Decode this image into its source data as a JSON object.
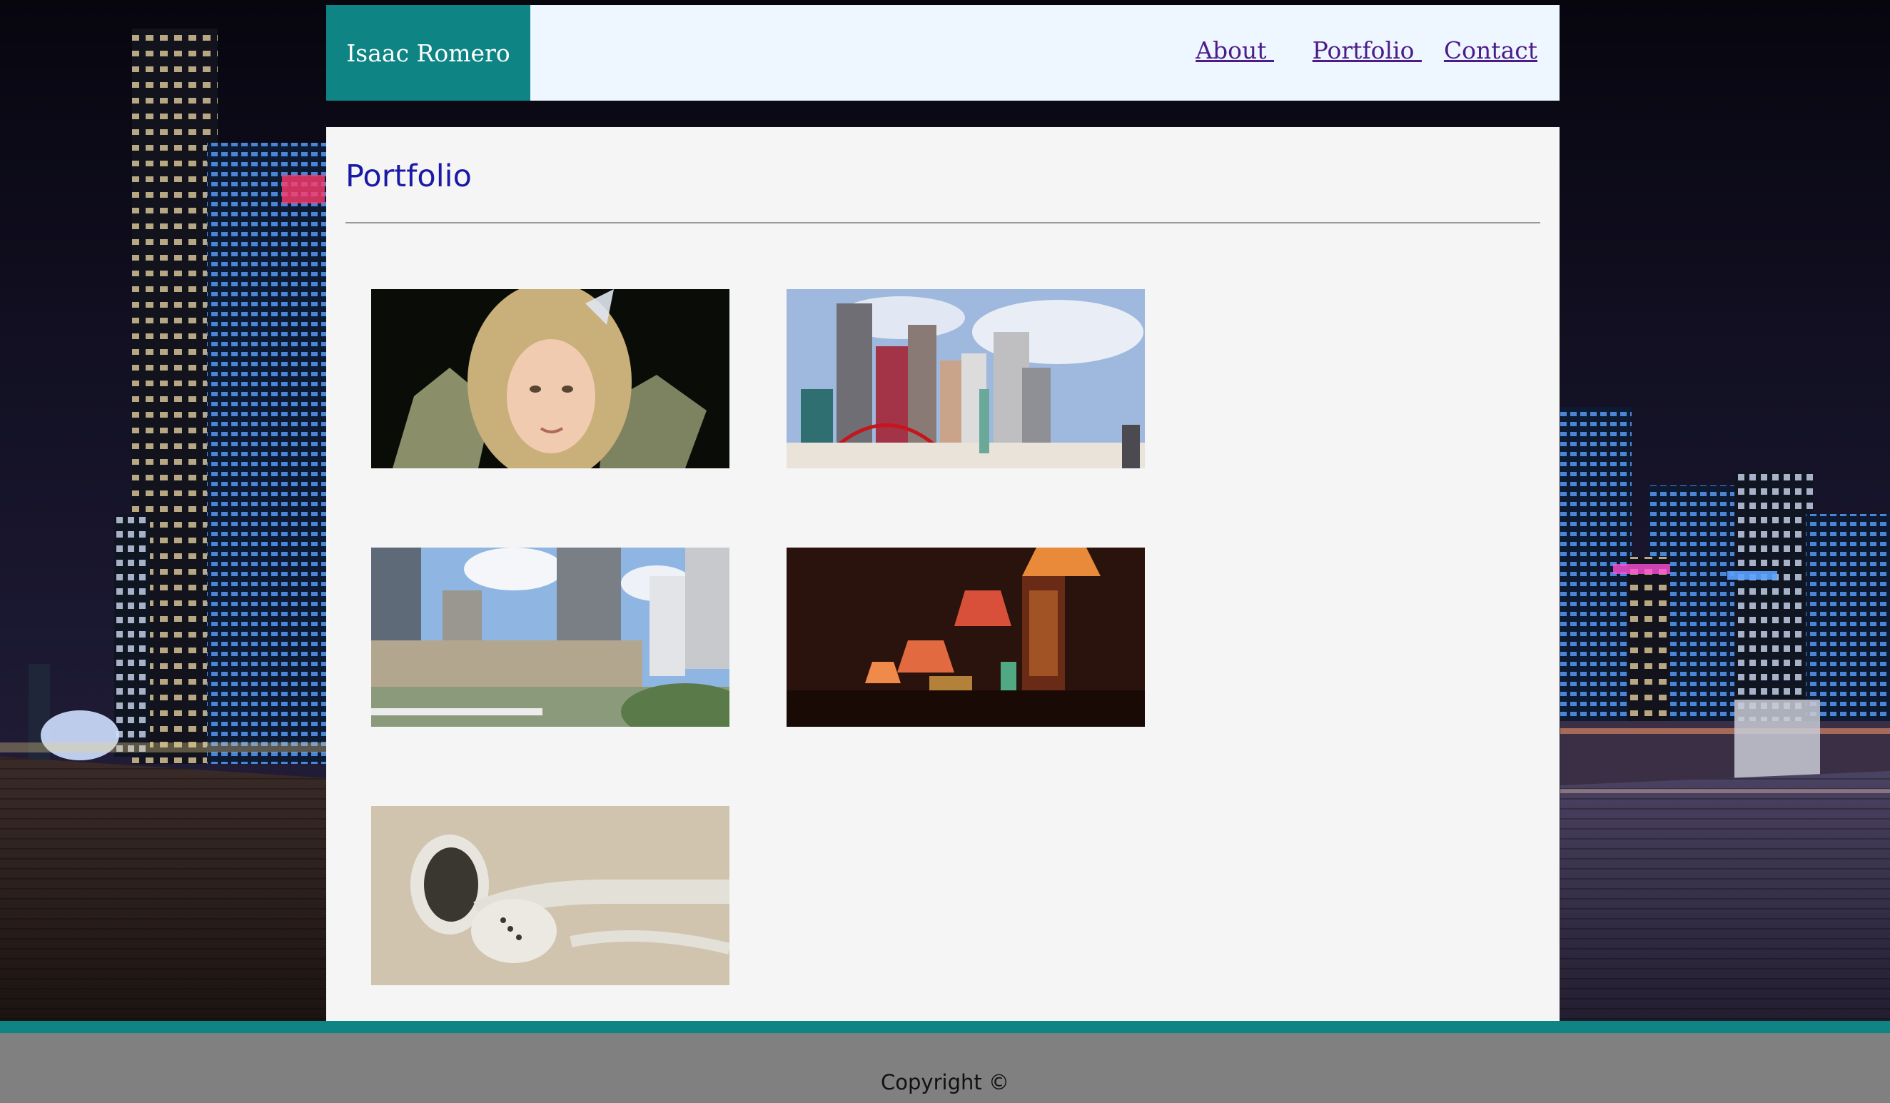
{
  "header": {
    "brand": "Isaac Romero",
    "nav": [
      {
        "label": "About "
      },
      {
        "label": "Portfolio "
      },
      {
        "label": "Contact"
      }
    ]
  },
  "main": {
    "title": "Portfolio",
    "gallery": [
      {
        "subject": "girl-with-butterfly"
      },
      {
        "subject": "new-york-new-york-skyline"
      },
      {
        "subject": "city-buildings-daytime"
      },
      {
        "subject": "hanging-lamps-shop"
      },
      {
        "subject": "white-earbuds"
      }
    ]
  },
  "footer": {
    "copyright": "Copyright ©"
  },
  "colors": {
    "accent": "#0e8584",
    "header_bg": "#eef7ff",
    "panel_bg": "#f5f5f5",
    "title": "#1a1aa6",
    "nav_link": "#4c1d8a",
    "footer_bg": "#808080"
  }
}
